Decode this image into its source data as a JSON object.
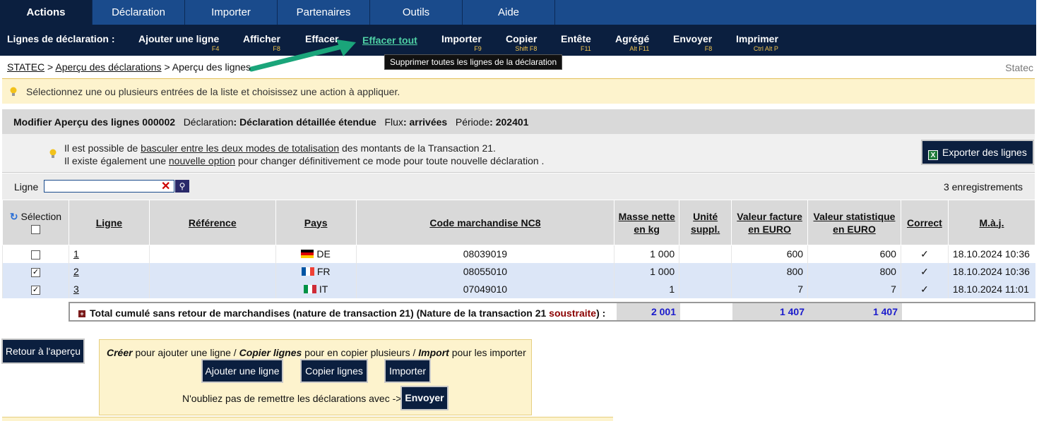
{
  "tabs": [
    "Actions",
    "Déclaration",
    "Importer",
    "Partenaires",
    "Outils",
    "Aide"
  ],
  "actionbar": {
    "lead": "Lignes de déclaration :",
    "items": [
      {
        "label": "Ajouter une ligne",
        "key": "F4"
      },
      {
        "label": "Afficher",
        "key": "F8"
      },
      {
        "label": "Effacer",
        "key": ""
      },
      {
        "label": "Effacer tout",
        "key": ""
      },
      {
        "label": "Importer",
        "key": "F9"
      },
      {
        "label": "Copier",
        "key": "Shift F8"
      },
      {
        "label": "Entête",
        "key": "F11"
      },
      {
        "label": "Agrégé",
        "key": "Alt F11"
      },
      {
        "label": "Envoyer",
        "key": "F8"
      },
      {
        "label": "Imprimer",
        "key": "Ctrl Alt P"
      }
    ]
  },
  "tooltip": "Supprimer toutes les lignes de la déclaration",
  "breadcrumb": {
    "root": "STATEC",
    "sep": ">",
    "mid": "Aperçu des déclarations",
    "current": "Aperçu des lignes"
  },
  "brand": "Statec",
  "info": "Sélectionnez une ou plusieurs entrées de la liste et choisissez une action à appliquer.",
  "panel": {
    "title": "Modifier Aperçu des lignes 000002",
    "decl_label": "Déclaration",
    "decl_value": ": Déclaration détaillée étendue",
    "flux_label": "Flux",
    "flux_value": ": arrivées",
    "period_label": "Période",
    "period_value": ": 202401",
    "l1_pre": "Il est possible de ",
    "l1_link": "basculer entre les deux modes de totalisation",
    "l1_post": " des montants de la Transaction 21.",
    "l2_pre": "Il existe également une ",
    "l2_link": "nouvelle option",
    "l2_post": " pour changer définitivement ce mode pour toute nouvelle déclaration .",
    "export": "Exporter des lignes"
  },
  "filter": {
    "label": "Ligne",
    "value": "",
    "count": "3 enregistrements"
  },
  "table": {
    "headers": [
      "Sélection",
      "Ligne",
      "Référence",
      "Pays",
      "Code marchandise NC8",
      "Masse nette en kg",
      "Unité suppl.",
      "Valeur facture en EURO",
      "Valeur statistique en EURO",
      "Correct",
      "M.à.j."
    ],
    "rows": [
      {
        "checked": false,
        "ligne": "1",
        "ref": "",
        "pays": "DE",
        "code": "08039019",
        "masse": "1 000",
        "unite": "",
        "facture": "600",
        "stat": "600",
        "correct": "✓",
        "maj": "18.10.2024 10:36"
      },
      {
        "checked": true,
        "ligne": "2",
        "ref": "",
        "pays": "FR",
        "code": "08055010",
        "masse": "1 000",
        "unite": "",
        "facture": "800",
        "stat": "800",
        "correct": "✓",
        "maj": "18.10.2024 10:36"
      },
      {
        "checked": true,
        "ligne": "3",
        "ref": "",
        "pays": "IT",
        "code": "07049010",
        "masse": "1",
        "unite": "",
        "facture": "7",
        "stat": "7",
        "correct": "✓",
        "maj": "18.10.2024 11:01"
      }
    ]
  },
  "total": {
    "label_pre": "Total cumulé sans retour de marchandises (nature de transaction 21) (Nature de la transaction 21 ",
    "label_red": "soustraite",
    "label_post": ") :",
    "masse": "2 001",
    "facture": "1 407",
    "stat": "1 407"
  },
  "bottom": {
    "back": "Retour à l'aperçu",
    "create_b": "Créer",
    "create_t": " pour ajouter une ligne / ",
    "copy_b": "Copier lignes",
    "copy_t": " pour en copier plusieurs / ",
    "import_b": "Import",
    "import_t": " pour les importer",
    "btn_add": "Ajouter une ligne",
    "btn_copy": "Copier lignes",
    "btn_import": "Importer",
    "remind": "N'oubliez pas de remettre les déclarations avec ->",
    "btn_send": "Envoyer"
  },
  "colors": {
    "nav": "#0b1f3f",
    "tab": "#1a4b8c",
    "highlight": "#4fd1a5",
    "banner": "#fdf3cd"
  }
}
